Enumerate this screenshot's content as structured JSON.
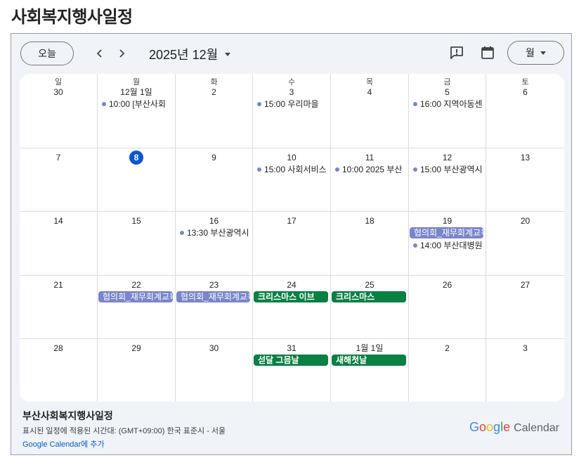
{
  "page": {
    "title": "사회복지행사일정"
  },
  "toolbar": {
    "today_label": "오늘",
    "prev_icon": "chevron-left-icon",
    "next_icon": "chevron-right-icon",
    "month_label": "2025년 12월",
    "view_label": "월",
    "feedback_icon": "feedback-icon",
    "calendar_icon": "calendar-icon"
  },
  "calendar": {
    "weekdays": [
      "일",
      "월",
      "화",
      "수",
      "목",
      "금",
      "토"
    ],
    "weeks": [
      {
        "days": [
          {
            "label": "30",
            "events": []
          },
          {
            "label": "12월 1일",
            "events": [
              {
                "kind": "dot",
                "text": "10:00 [부산사회"
              }
            ]
          },
          {
            "label": "2",
            "events": []
          },
          {
            "label": "3",
            "events": [
              {
                "kind": "dot",
                "text": "15:00 우리마을"
              }
            ]
          },
          {
            "label": "4",
            "events": []
          },
          {
            "label": "5",
            "events": [
              {
                "kind": "dot",
                "text": "16:00 지역아동센"
              }
            ]
          },
          {
            "label": "6",
            "events": []
          }
        ]
      },
      {
        "days": [
          {
            "label": "7",
            "events": []
          },
          {
            "label": "8",
            "today": true,
            "events": []
          },
          {
            "label": "9",
            "events": []
          },
          {
            "label": "10",
            "events": [
              {
                "kind": "dot",
                "text": "15:00 사회서비스"
              }
            ]
          },
          {
            "label": "11",
            "events": [
              {
                "kind": "dot",
                "text": "10:00 2025 부산"
              }
            ]
          },
          {
            "label": "12",
            "events": [
              {
                "kind": "dot",
                "text": "15:00 부산광역시"
              }
            ]
          },
          {
            "label": "13",
            "events": []
          }
        ]
      },
      {
        "days": [
          {
            "label": "14",
            "events": []
          },
          {
            "label": "15",
            "events": []
          },
          {
            "label": "16",
            "events": [
              {
                "kind": "dot",
                "text": "13:30 부산광역시"
              }
            ]
          },
          {
            "label": "17",
            "events": []
          },
          {
            "label": "18",
            "events": []
          },
          {
            "label": "19",
            "events": [
              {
                "kind": "bar-purple",
                "text": "협의회_재무회계교육"
              },
              {
                "kind": "dot",
                "text": "14:00 부산대병원"
              }
            ]
          },
          {
            "label": "20",
            "events": []
          }
        ]
      },
      {
        "days": [
          {
            "label": "21",
            "events": []
          },
          {
            "label": "22",
            "events": [
              {
                "kind": "bar-purple",
                "text": "협의회_재무회계교육"
              }
            ]
          },
          {
            "label": "23",
            "events": [
              {
                "kind": "bar-purple",
                "text": "협의회_재무회계교육"
              }
            ]
          },
          {
            "label": "24",
            "events": [
              {
                "kind": "bar-green",
                "text": "크리스마스 이브"
              }
            ]
          },
          {
            "label": "25",
            "events": [
              {
                "kind": "bar-green",
                "text": "크리스마스"
              }
            ]
          },
          {
            "label": "26",
            "events": []
          },
          {
            "label": "27",
            "events": []
          }
        ]
      },
      {
        "days": [
          {
            "label": "28",
            "events": []
          },
          {
            "label": "29",
            "events": []
          },
          {
            "label": "30",
            "events": []
          },
          {
            "label": "31",
            "events": [
              {
                "kind": "bar-green",
                "text": "섣달 그믐날"
              }
            ]
          },
          {
            "label": "1월 1일",
            "events": [
              {
                "kind": "bar-green",
                "text": "새해첫날"
              }
            ]
          },
          {
            "label": "2",
            "events": []
          },
          {
            "label": "3",
            "events": []
          }
        ]
      }
    ]
  },
  "footer": {
    "calendar_name": "부산사회복지행사일정",
    "timezone_text": "표시된 일정에 적용된 시간대: (GMT+09:00) 한국 표준시 - 서울",
    "add_link": "Google Calendar에 추가",
    "logo_google": [
      "G",
      "o",
      "o",
      "g",
      "l",
      "e"
    ],
    "logo_colors": [
      "#4285f4",
      "#ea4335",
      "#fbbc05",
      "#4285f4",
      "#34a853",
      "#ea4335"
    ],
    "logo_calendar": "Calendar"
  },
  "colors": {
    "today": "#0b57d0",
    "event_dot": "#7986cb",
    "bar_purple": "#7986cb",
    "bar_green": "#0b8043"
  }
}
